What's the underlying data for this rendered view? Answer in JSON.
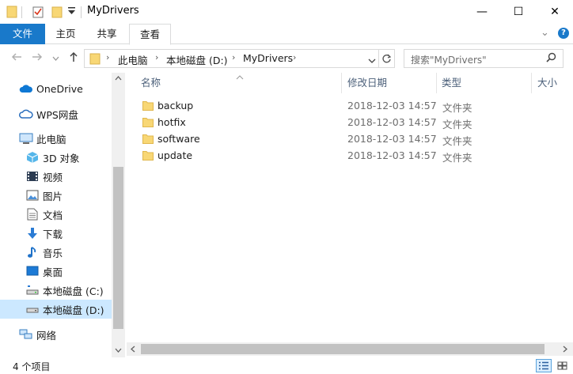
{
  "window": {
    "title": "MyDrivers",
    "minimize_glyph": "—",
    "maximize_glyph": "☐",
    "close_glyph": "✕"
  },
  "ribbon": {
    "tabs": [
      {
        "label": "文件"
      },
      {
        "label": "主页"
      },
      {
        "label": "共享"
      },
      {
        "label": "查看"
      }
    ],
    "expand_glyph": "⌄",
    "help_glyph": "?"
  },
  "address": {
    "parts": [
      "此电脑",
      "本地磁盘 (D:)",
      "MyDrivers"
    ],
    "search_placeholder": "搜索\"MyDrivers\""
  },
  "nav": {
    "items": [
      {
        "label": "OneDrive",
        "icon": "cloud-icon"
      },
      {
        "label": "WPS网盘",
        "icon": "wps-cloud-icon"
      },
      {
        "label": "此电脑",
        "icon": "computer-icon"
      },
      {
        "label": "3D 对象",
        "icon": "cube-icon"
      },
      {
        "label": "视频",
        "icon": "video-icon"
      },
      {
        "label": "图片",
        "icon": "picture-icon"
      },
      {
        "label": "文档",
        "icon": "document-icon"
      },
      {
        "label": "下载",
        "icon": "download-icon"
      },
      {
        "label": "音乐",
        "icon": "music-icon"
      },
      {
        "label": "桌面",
        "icon": "desktop-icon"
      },
      {
        "label": "本地磁盘 (C:)",
        "icon": "drive-c-icon"
      },
      {
        "label": "本地磁盘 (D:)",
        "icon": "drive-d-icon"
      },
      {
        "label": "网络",
        "icon": "network-icon"
      }
    ],
    "selected_index": 11
  },
  "columns": {
    "name": "名称",
    "date": "修改日期",
    "type": "类型",
    "size": "大小"
  },
  "files": [
    {
      "name": "backup",
      "date": "2018-12-03 14:57",
      "type": "文件夹"
    },
    {
      "name": "hotfix",
      "date": "2018-12-03 14:57",
      "type": "文件夹"
    },
    {
      "name": "software",
      "date": "2018-12-03 14:57",
      "type": "文件夹"
    },
    {
      "name": "update",
      "date": "2018-12-03 14:57",
      "type": "文件夹"
    }
  ],
  "status": {
    "item_count": "4 个项目"
  },
  "colors": {
    "accent": "#1979ca",
    "folder": "#f8d775",
    "selection": "#cce8ff"
  }
}
